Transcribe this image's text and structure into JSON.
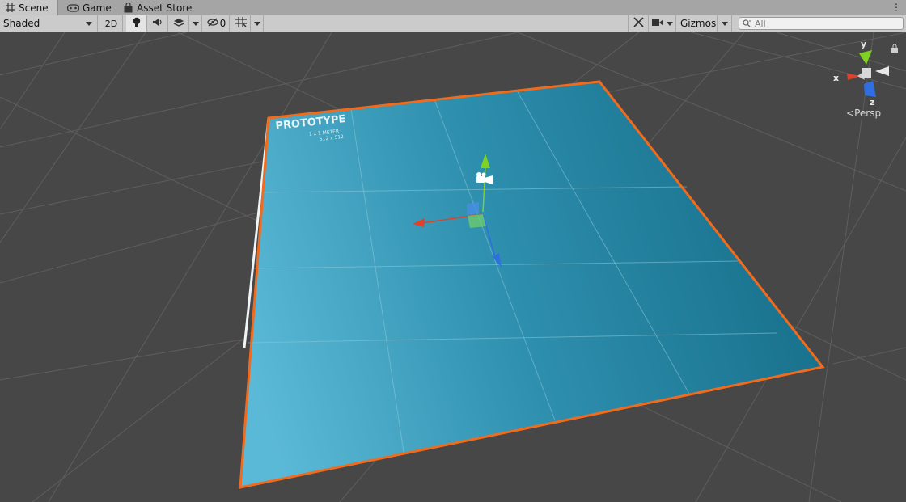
{
  "tabs": [
    {
      "label": "Scene",
      "icon": "grid-icon",
      "active": true
    },
    {
      "label": "Game",
      "icon": "gamepad-icon",
      "active": false
    },
    {
      "label": "Asset Store",
      "icon": "shopping-bag-icon",
      "active": false
    }
  ],
  "toolbar": {
    "draw_mode": "Shaded",
    "mode_2d": "2D",
    "hidden_count": "0",
    "gizmos_label": "Gizmos",
    "search_placeholder": "All"
  },
  "scene_gizmo": {
    "x_label": "x",
    "y_label": "y",
    "z_label": "z",
    "projection": "Persp"
  },
  "plane_texture": {
    "title": "PROTOTYPE",
    "line1": "1 x 1 METER",
    "line2": "512 x 512"
  },
  "colors": {
    "selection_outline": "#f26b1d",
    "plane_top": "#2e8fae",
    "axis_x": "#e0412c",
    "axis_y": "#7ed321",
    "axis_z": "#2f6fe0"
  }
}
